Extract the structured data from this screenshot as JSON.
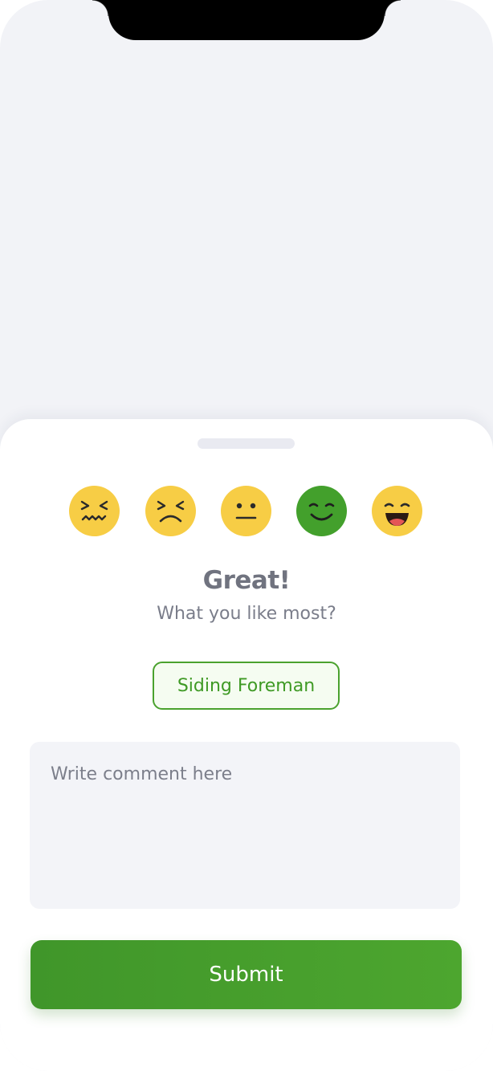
{
  "rating": {
    "options": [
      {
        "name": "confounded-face-icon",
        "color": "#f7cd45"
      },
      {
        "name": "persevering-face-icon",
        "color": "#f7cd45"
      },
      {
        "name": "neutral-face-icon",
        "color": "#f7cd45"
      },
      {
        "name": "smiling-face-icon",
        "color": "#43a02c",
        "selected": true
      },
      {
        "name": "grinning-face-icon",
        "color": "#f7cd45"
      }
    ],
    "title": "Great!",
    "subtitle": "What you like most?"
  },
  "tag": {
    "label": "Siding Foreman",
    "border_color": "#4aa22e"
  },
  "comment": {
    "placeholder": "Write comment here",
    "value": ""
  },
  "submit": {
    "label": "Submit",
    "color": "#43a02c"
  }
}
